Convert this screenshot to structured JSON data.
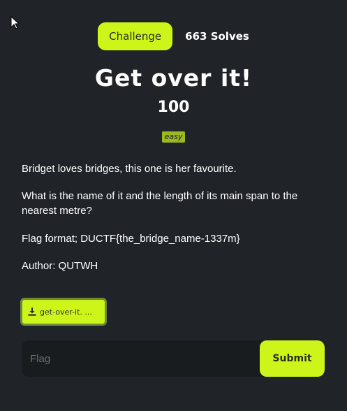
{
  "tabs": {
    "challenge_label": "Challenge",
    "solves_label": "663 Solves"
  },
  "challenge": {
    "title": "Get over it!",
    "points": "100",
    "difficulty": "easy",
    "description": [
      "Bridget loves bridges, this one is her favourite.",
      "What is the name of it and the length of its main span to the nearest metre?",
      "Flag format; DUCTF{the_bridge_name-1337m}",
      "Author: QUTWH"
    ],
    "file_label": "get-over-it. ..."
  },
  "form": {
    "flag_placeholder": "Flag",
    "submit_label": "Submit"
  },
  "icons": {
    "cursor": "mouse-pointer-icon",
    "download": "download-icon"
  },
  "colors": {
    "background": "#202428",
    "accent": "#cdf51a",
    "badge": "#9cb820",
    "input_bg": "#191c1f"
  }
}
